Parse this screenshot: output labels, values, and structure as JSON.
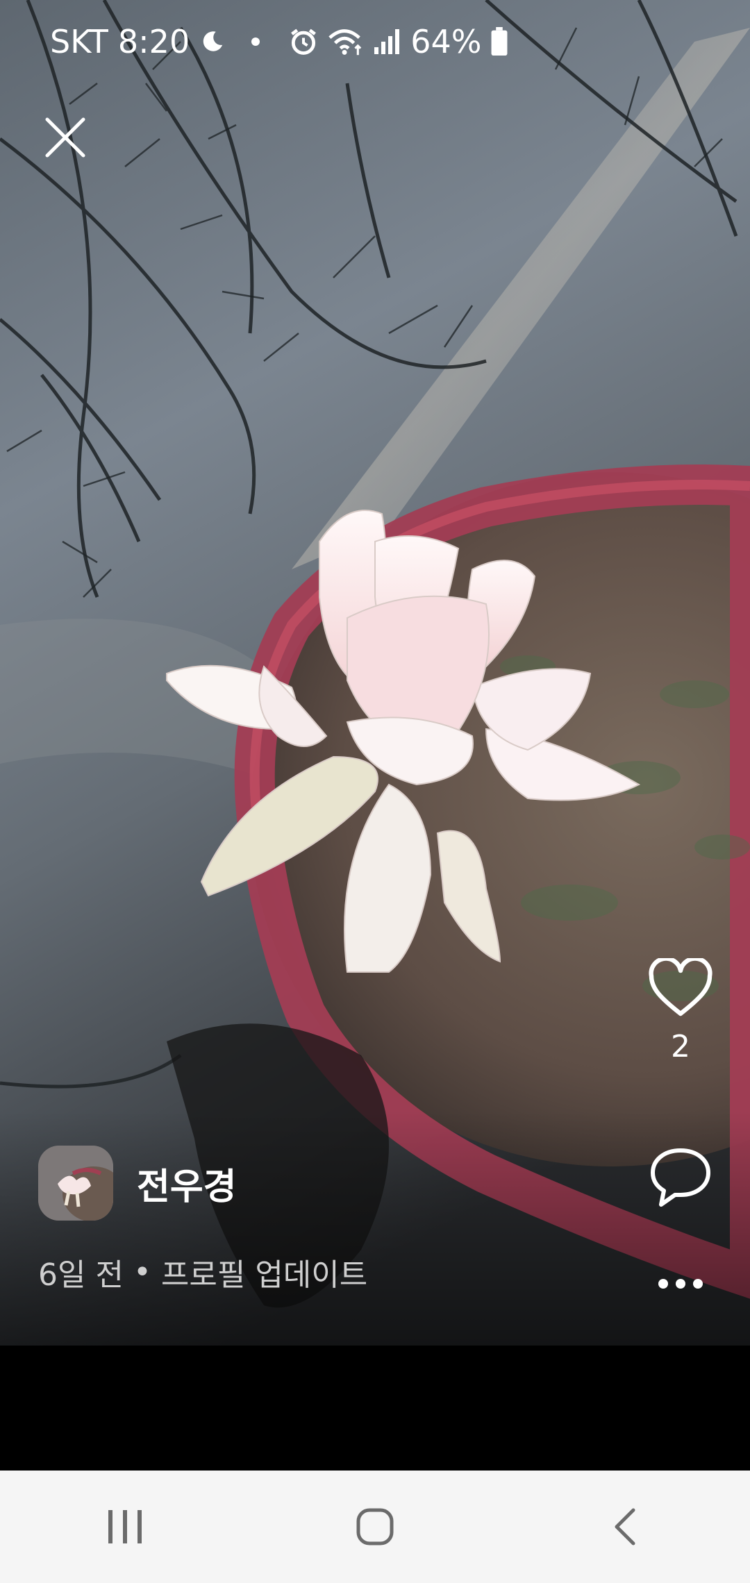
{
  "status_bar": {
    "carrier": "SKT",
    "time": "8:20",
    "battery_percent": "64%",
    "icons": [
      "moon-icon",
      "notification-dot-icon",
      "alarm-icon",
      "wifi-icon",
      "signal-icon",
      "battery-icon"
    ]
  },
  "profile": {
    "name": "전우경",
    "time_ago": "6일 전",
    "separator": "•",
    "activity": "프로필 업데이트"
  },
  "actions": {
    "like_count": "2",
    "icons": [
      "heart-icon",
      "comment-icon",
      "more-icon"
    ]
  },
  "nav": {
    "icons": [
      "recent-apps-icon",
      "home-icon",
      "back-icon"
    ]
  },
  "colors": {
    "nav_background": "#f5f5f5",
    "nav_icon": "#6b6b6b",
    "meta_text": "#cfcfcf"
  }
}
